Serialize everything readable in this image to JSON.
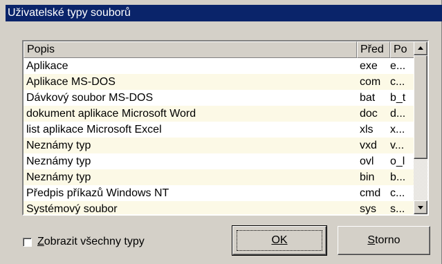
{
  "window": {
    "title": "Uživatelské typy souborů"
  },
  "list": {
    "columns": [
      "Popis",
      "Před",
      "Po"
    ],
    "rows": [
      [
        "Aplikace",
        "exe",
        "e..."
      ],
      [
        "Aplikace MS-DOS",
        "com",
        "c..."
      ],
      [
        "Dávkový soubor MS-DOS",
        "bat",
        "b_t"
      ],
      [
        "dokument aplikace Microsoft Word",
        "doc",
        "d..."
      ],
      [
        "list aplikace Microsoft Excel",
        "xls",
        "x..."
      ],
      [
        "Neznámy typ",
        "vxd",
        "v..."
      ],
      [
        "Neznámy typ",
        "ovl",
        "o_l"
      ],
      [
        "Neznámy typ",
        "bin",
        "b..."
      ],
      [
        "Předpis příkazů Windows NT",
        "cmd",
        "c..."
      ],
      [
        "Systémový soubor",
        "sys",
        "s..."
      ]
    ]
  },
  "checkbox": {
    "label_first": "Z",
    "label_rest": "obrazit všechny typy",
    "checked": false
  },
  "buttons": {
    "ok": {
      "label": "OK"
    },
    "cancel": {
      "label_first": "S",
      "label_rest": "torno"
    }
  },
  "colors": {
    "title_bg": "#0a246a",
    "alt_row": "#fcf9e6",
    "face": "#d4d0c8"
  }
}
